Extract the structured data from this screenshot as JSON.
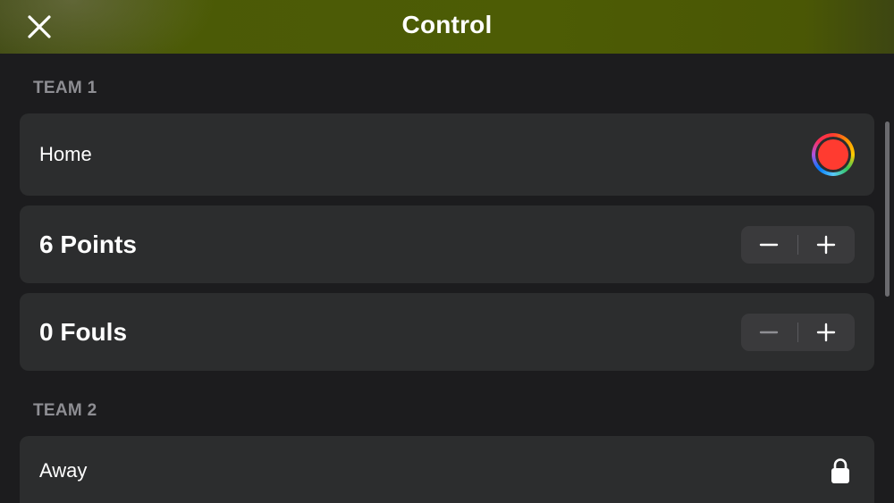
{
  "header": {
    "title": "Control",
    "close_icon": "close-icon"
  },
  "team1": {
    "section_label": "TEAM 1",
    "name": "Home",
    "color": "#ff3b30",
    "points_label": "6 Points",
    "points": 6,
    "fouls_label": "0 Fouls",
    "fouls": 0
  },
  "team2": {
    "section_label": "TEAM 2",
    "name": "Away",
    "status_icon": "lock-icon"
  },
  "colors": {
    "header_bg": "#4b5a06",
    "page_bg": "#1c1c1e",
    "row_bg": "#2c2d2e",
    "stepper_bg": "#3a3a3c",
    "disabled": "#8e8e93"
  }
}
